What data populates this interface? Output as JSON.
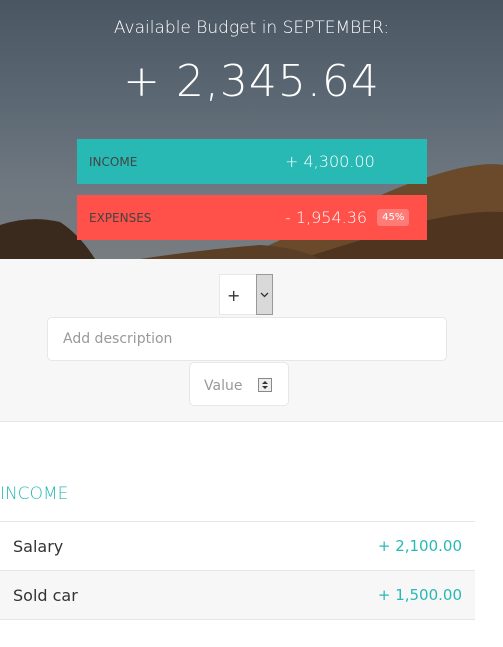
{
  "header": {
    "title": "Available Budget in SEPTEMBER:",
    "total": "+ 2,345.64"
  },
  "summary": {
    "income": {
      "label": "Income",
      "value": "+ 4,300.00"
    },
    "expenses": {
      "label": "Expenses",
      "value": "- 1,954.36",
      "percentage": "45%"
    }
  },
  "add_form": {
    "type_value": "+",
    "description_placeholder": "Add description",
    "value_placeholder": "Value"
  },
  "income_section": {
    "title": "Income",
    "items": [
      {
        "description": "Salary",
        "value": "+ 2,100.00"
      },
      {
        "description": "Sold car",
        "value": "+ 1,500.00"
      }
    ]
  },
  "colors": {
    "income": "#28b9b5",
    "expenses": "#ff5049"
  }
}
